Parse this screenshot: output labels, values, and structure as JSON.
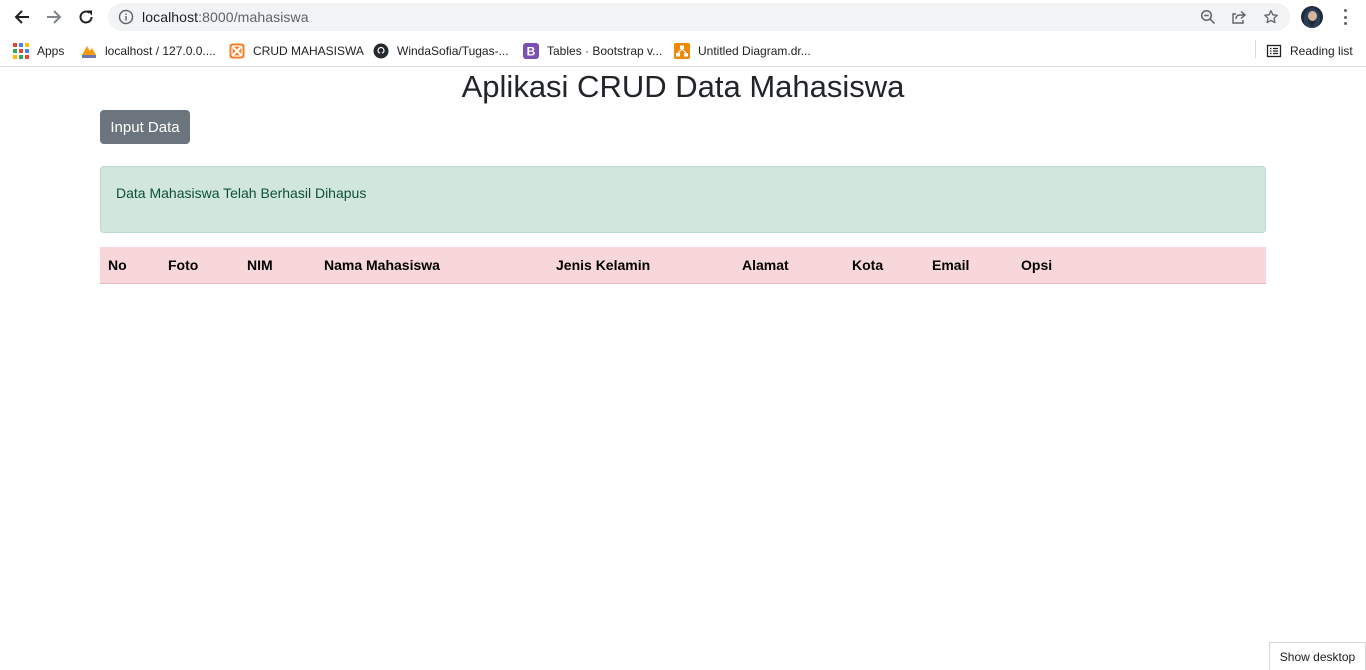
{
  "browser": {
    "url_host": "localhost",
    "url_path": ":8000/mahasiswa",
    "icons": [
      "back-arrow-icon",
      "forward-arrow-icon",
      "reload-icon",
      "info-icon",
      "zoom-icon",
      "share-icon",
      "star-icon",
      "avatar",
      "more-menu-icon"
    ]
  },
  "bookmarks": {
    "items": [
      {
        "label": "Apps",
        "icon": "apps-grid-icon"
      },
      {
        "label": "localhost / 127.0.0....",
        "icon": "phpmyadmin-icon"
      },
      {
        "label": "CRUD MAHASISWA",
        "icon": "xampp-icon"
      },
      {
        "label": "WindaSofia/Tugas-...",
        "icon": "github-icon"
      },
      {
        "label": "Tables · Bootstrap v...",
        "icon": "bootstrap-icon"
      },
      {
        "label": "Untitled Diagram.dr...",
        "icon": "drawio-icon"
      }
    ],
    "reading_list": "Reading list"
  },
  "page": {
    "title": "Aplikasi CRUD Data Mahasiswa",
    "input_button": "Input Data",
    "alert": "Data Mahasiswa Telah Berhasil Dihapus"
  },
  "table": {
    "columns": [
      "No",
      "Foto",
      "NIM",
      "Nama Mahasiswa",
      "Jenis Kelamin",
      "Alamat",
      "Kota",
      "Email",
      "Opsi"
    ],
    "rows": []
  },
  "taskbar": {
    "show_desktop": "Show desktop"
  },
  "colors": {
    "button_secondary": "#6c757d",
    "alert_success_bg": "#d1e7dd",
    "alert_success_text": "#0f5132",
    "table_danger_bg": "#f8d7da"
  }
}
